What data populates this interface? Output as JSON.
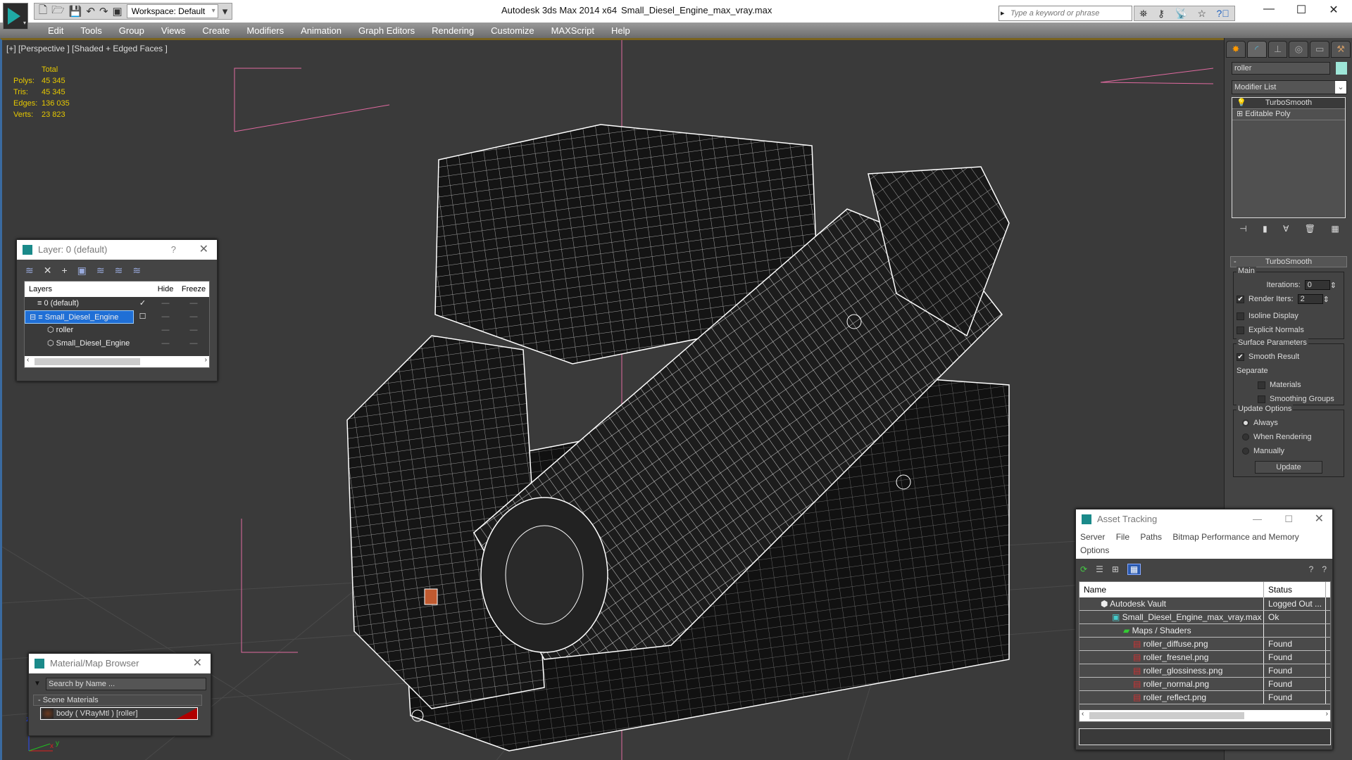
{
  "titlebar": {
    "app_title": "Autodesk 3ds Max  2014 x64",
    "file_name": "Small_Diesel_Engine_max_vray.max",
    "workspace": "Workspace: Default",
    "search_placeholder": "Type a keyword or phrase",
    "minimize": "—",
    "maximize": "☐",
    "close": "✕"
  },
  "menu": [
    "Edit",
    "Tools",
    "Group",
    "Views",
    "Create",
    "Modifiers",
    "Animation",
    "Graph Editors",
    "Rendering",
    "Customize",
    "MAXScript",
    "Help"
  ],
  "viewport": {
    "label": "[+] [Perspective ] [Shaded + Edged Faces ]",
    "stats": {
      "header": "Total",
      "rows": [
        {
          "k": "Polys:",
          "v": "45 345"
        },
        {
          "k": "Tris:",
          "v": "45 345"
        },
        {
          "k": "Edges:",
          "v": "136 035"
        },
        {
          "k": "Verts:",
          "v": "23 823"
        }
      ]
    },
    "wire_color": "#ffffff",
    "pink_guide": "#e06aa0"
  },
  "layer_window": {
    "title": "Layer: 0 (default)",
    "help": "?",
    "close": "✕",
    "columns": [
      "Layers",
      "",
      "Hide",
      "Freeze"
    ],
    "rows": [
      {
        "name": "0 (default)",
        "current": "✓",
        "hide": "—",
        "freeze": "—",
        "indent": 1,
        "selected": false
      },
      {
        "name": "Small_Diesel_Engine",
        "current": "☐",
        "hide": "—",
        "freeze": "—",
        "indent": 0,
        "selected": true
      },
      {
        "name": "roller",
        "current": "",
        "hide": "—",
        "freeze": "—",
        "indent": 2,
        "selected": false
      },
      {
        "name": "Small_Diesel_Engine",
        "current": "",
        "hide": "—",
        "freeze": "—",
        "indent": 2,
        "selected": false
      }
    ]
  },
  "command_panel": {
    "object_name": "roller",
    "object_color": "#9ee6d8",
    "modifier_list": "Modifier List",
    "stack": [
      "TurboSmooth",
      "Editable Poly"
    ],
    "rollout_title": "TurboSmooth",
    "main_label": "Main",
    "iterations_label": "Iterations:",
    "iterations_value": "0",
    "render_iters_label": "Render Iters:",
    "render_iters_value": "2",
    "render_iters_checked": true,
    "isoline_label": "Isoline Display",
    "explicit_normals_label": "Explicit Normals",
    "surface_label": "Surface Parameters",
    "smooth_result_label": "Smooth Result",
    "separate_label": "Separate",
    "materials_label": "Materials",
    "smoothing_groups_label": "Smoothing Groups",
    "update_options_label": "Update Options",
    "always_label": "Always",
    "when_rendering_label": "When Rendering",
    "manually_label": "Manually",
    "update_button": "Update"
  },
  "asset_tracking": {
    "title": "Asset Tracking",
    "menu": [
      "Server",
      "File",
      "Paths",
      "Bitmap Performance and Memory",
      "Options"
    ],
    "columns": [
      "Name",
      "Status"
    ],
    "rows": [
      {
        "name": "Autodesk Vault",
        "status": "Logged Out ...",
        "indent": 1,
        "icon": "vault-icon"
      },
      {
        "name": "Small_Diesel_Engine_max_vray.max",
        "status": "Ok",
        "indent": 2,
        "icon": "max-file-icon"
      },
      {
        "name": "Maps / Shaders",
        "status": "",
        "indent": 3,
        "icon": "maps-icon"
      },
      {
        "name": "roller_diffuse.png",
        "status": "Found",
        "indent": 4,
        "icon": "png-icon"
      },
      {
        "name": "roller_fresnel.png",
        "status": "Found",
        "indent": 4,
        "icon": "png-icon"
      },
      {
        "name": "roller_glossiness.png",
        "status": "Found",
        "indent": 4,
        "icon": "png-icon"
      },
      {
        "name": "roller_normal.png",
        "status": "Found",
        "indent": 4,
        "icon": "png-icon"
      },
      {
        "name": "roller_reflect.png",
        "status": "Found",
        "indent": 4,
        "icon": "png-icon"
      }
    ]
  },
  "material_browser": {
    "title": "Material/Map Browser",
    "search_placeholder": "Search by Name ...",
    "section": "- Scene Materials",
    "item": "body  ( VRayMtl )  [roller]"
  }
}
